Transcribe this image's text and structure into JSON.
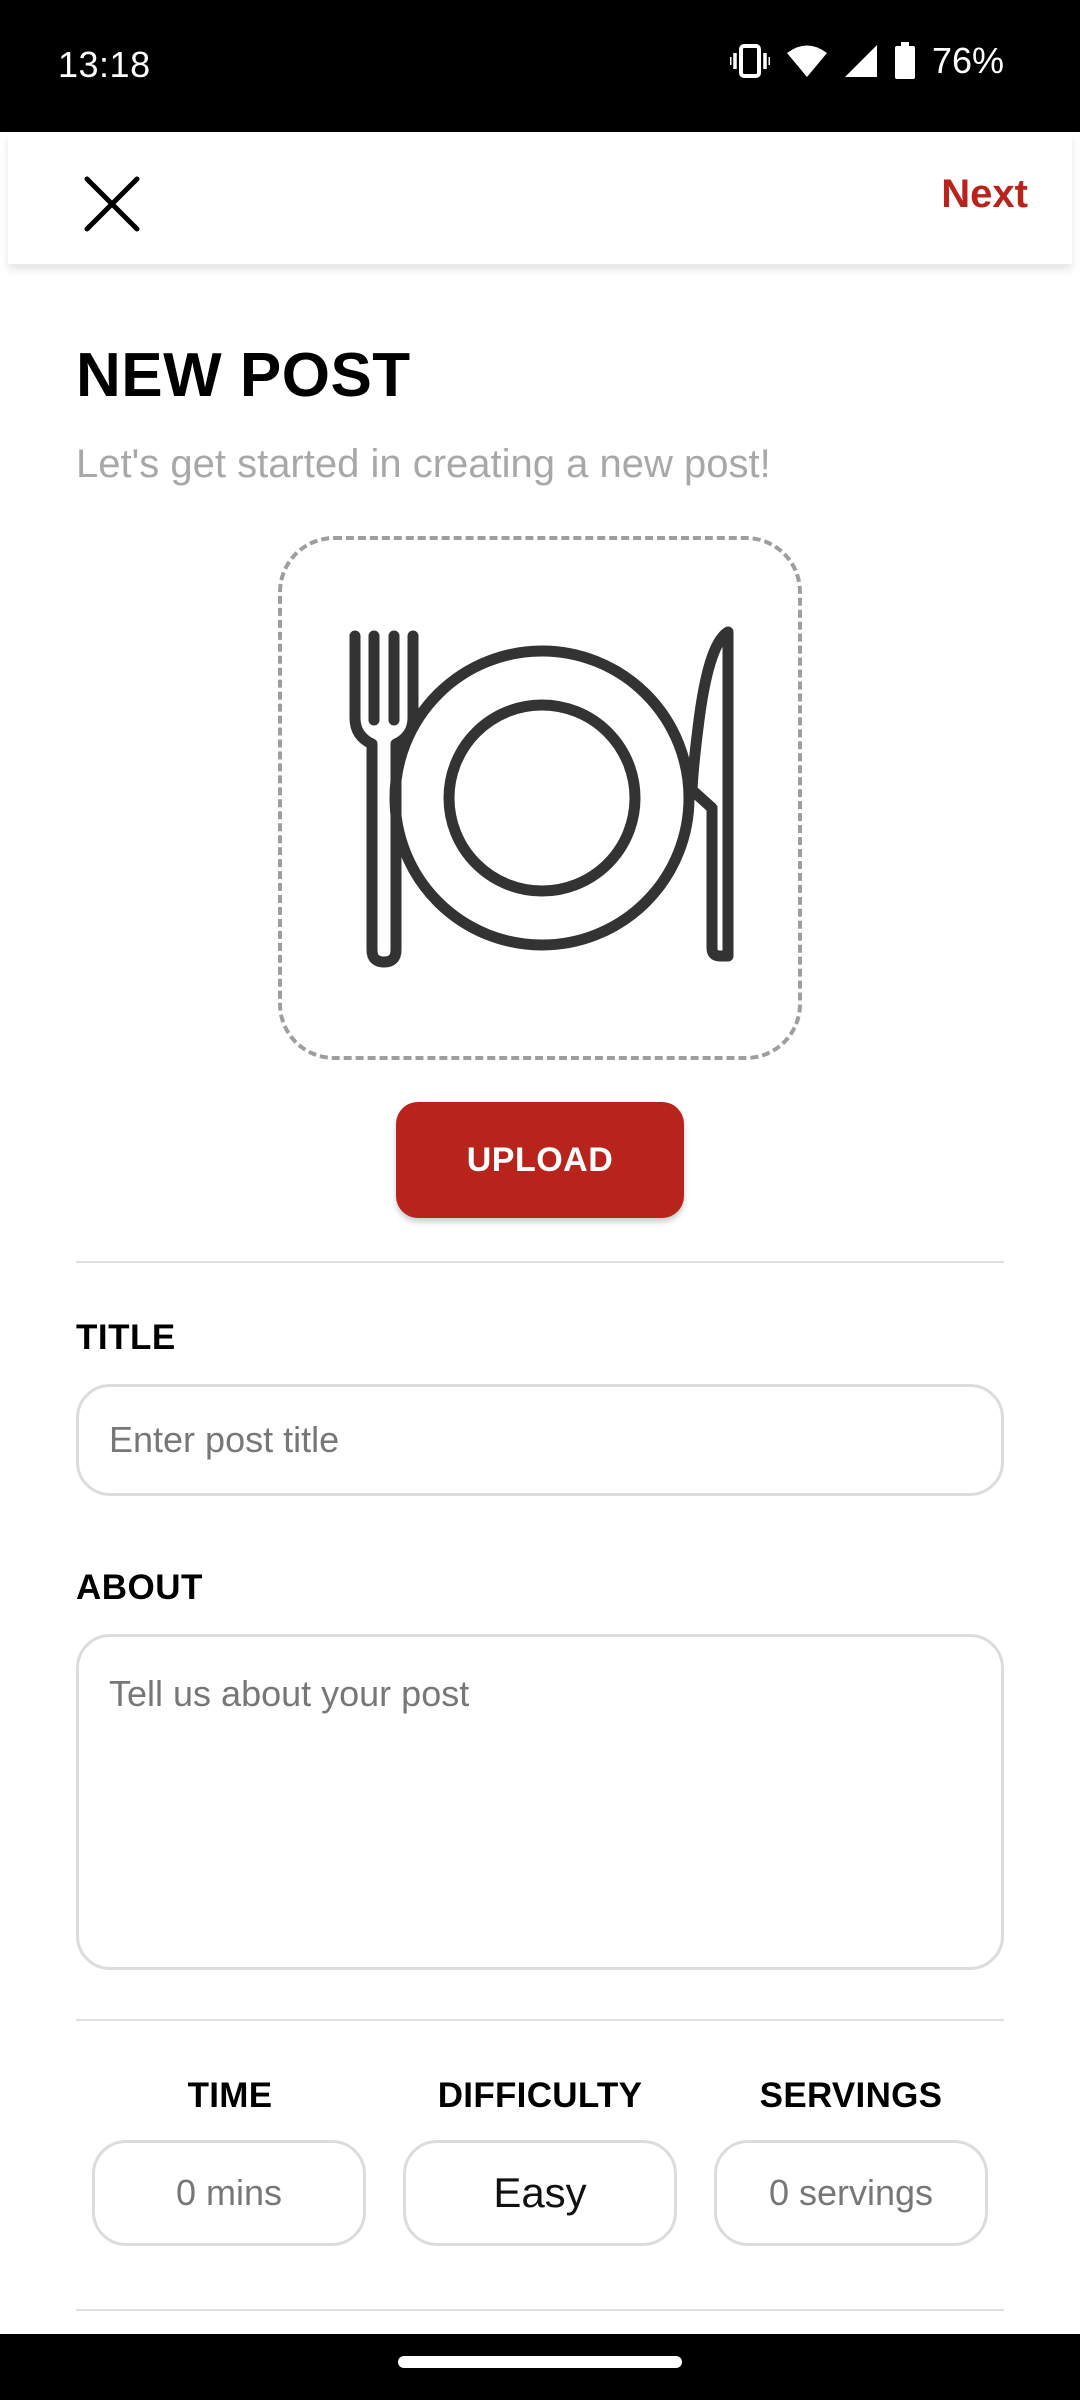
{
  "status_bar": {
    "time": "13:18",
    "battery_percent": "76%",
    "icons": [
      "vibrate-icon",
      "wifi-icon",
      "signal-icon",
      "battery-icon"
    ]
  },
  "top_bar": {
    "close_icon": "close-icon",
    "next_label": "Next"
  },
  "header": {
    "title": "NEW POST",
    "subtitle": "Let's get started in creating a new post!"
  },
  "image_picker": {
    "icon": "plate-cutlery-icon",
    "upload_label": "UPLOAD"
  },
  "form": {
    "title_label": "TITLE",
    "title_placeholder": "Enter post title",
    "title_value": "",
    "about_label": "ABOUT",
    "about_placeholder": "Tell us about your post",
    "about_value": ""
  },
  "stats": {
    "time_label": "TIME",
    "time_value": "0 mins",
    "difficulty_label": "DIFFICULTY",
    "difficulty_value": "Easy",
    "servings_label": "SERVINGS",
    "servings_value": "0 servings"
  },
  "colors": {
    "accent": "#b8231c",
    "subtitle": "#a8a8a8",
    "border": "#dcdcdc"
  }
}
